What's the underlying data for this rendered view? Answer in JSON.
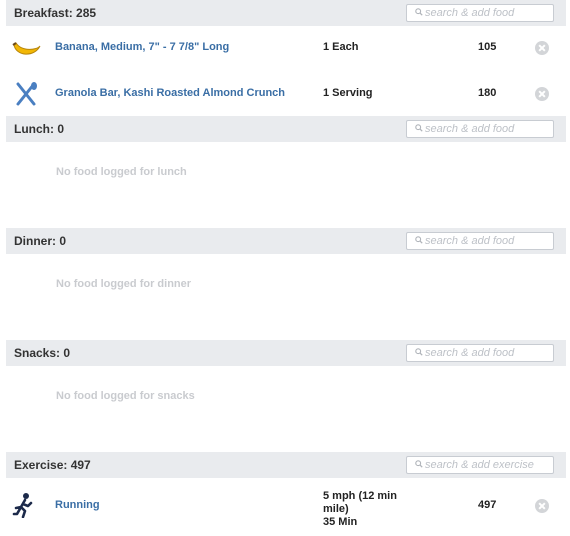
{
  "meals": {
    "breakfast": {
      "title": "Breakfast: 285",
      "search_placeholder": "search & add food",
      "items": [
        {
          "name": "Banana, Medium, 7\" - 7 7/8\" Long",
          "quantity": "1 Each",
          "calories": "105",
          "icon": "banana-icon"
        },
        {
          "name": "Granola Bar, Kashi Roasted Almond Crunch",
          "quantity": "1 Serving",
          "calories": "180",
          "icon": "fork-knife-icon"
        }
      ]
    },
    "lunch": {
      "title": "Lunch: 0",
      "search_placeholder": "search & add food",
      "empty_message": "No food logged for lunch"
    },
    "dinner": {
      "title": "Dinner: 0",
      "search_placeholder": "search & add food",
      "empty_message": "No food logged for dinner"
    },
    "snacks": {
      "title": "Snacks: 0",
      "search_placeholder": "search & add food",
      "empty_message": "No food logged for snacks"
    }
  },
  "exercise": {
    "title": "Exercise: 497",
    "search_placeholder": "search & add exercise",
    "items": [
      {
        "name": "Running",
        "quantity_line1": "5 mph (12 min",
        "quantity_line2": "mile)",
        "quantity_line3": "35 Min",
        "calories": "497",
        "icon": "runner-icon"
      }
    ]
  },
  "colors": {
    "header_bg": "#e9ebee",
    "link": "#3a6ea5",
    "muted": "#c9cbcf"
  }
}
